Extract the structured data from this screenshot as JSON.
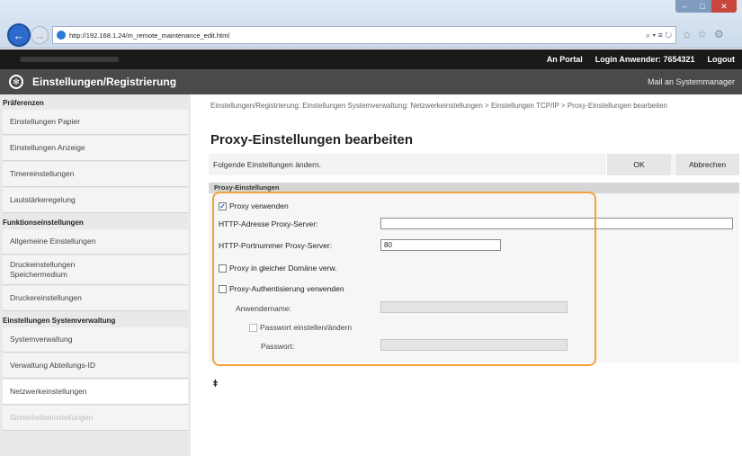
{
  "browser": {
    "url": "http://192.168.1.24/m_remote_maintenance_edit.html",
    "address_tools": "⌕ ▾ ≡ ↻"
  },
  "topbar": {
    "portal": "An Portal",
    "login_label": "Login Anwender:",
    "login_id": "7654321",
    "logout": "Logout"
  },
  "header": {
    "title": "Einstellungen/Registrierung",
    "mail": "Mail an Systemmanager"
  },
  "sidebar": {
    "groups": [
      {
        "label": "Präferenzen",
        "items": [
          "Einstellungen Papier",
          "Einstellungen Anzeige",
          "Timereinstellungen",
          "Lautstärkeregelung"
        ]
      },
      {
        "label": "Funktionseinstellungen",
        "items": [
          "Allgemeine Einstellungen",
          "Druckeinstellungen Speichermedium",
          "Druckereinstellungen"
        ]
      },
      {
        "label": "Einstellungen Systemverwaltung",
        "items": [
          "Systemverwaltung",
          "Verwaltung Abteilungs-ID",
          "Netzwerkeinstellungen",
          "Sicherheitseinstellungen"
        ]
      }
    ]
  },
  "main": {
    "breadcrumb": "Einstellungen/Registrierung: Einstellungen Systemverwaltung: Netzwerkeinstellungen > Einstellungen TCP/IP > Proxy-Einstellungen bearbeiten",
    "title": "Proxy-Einstellungen bearbeiten",
    "message": "Folgende Einstellungen ändern.",
    "ok": "OK",
    "cancel": "Abbrechen",
    "section": "Proxy-Einstellungen",
    "use_proxy": {
      "label": "Proxy verwenden",
      "checked": true
    },
    "http_address": {
      "label": "HTTP-Adresse Proxy-Server:",
      "value": ""
    },
    "http_port": {
      "label": "HTTP-Portnummer Proxy-Server:",
      "value": "80"
    },
    "same_domain": {
      "label": "Proxy in gleicher Domäne verw.",
      "checked": false
    },
    "auth": {
      "label": "Proxy-Authentisierung verwenden",
      "checked": false
    },
    "username": {
      "label": "Anwendername:",
      "value": ""
    },
    "set_password": {
      "label": "Passwort einstellen/ändern",
      "checked": false
    },
    "password": {
      "label": "Passwort:",
      "value": ""
    },
    "top_anchor": "⯒"
  },
  "colors": {
    "highlight": "#f0a23a",
    "header": "#4a4a4a",
    "topbar": "#1a1a1a"
  }
}
